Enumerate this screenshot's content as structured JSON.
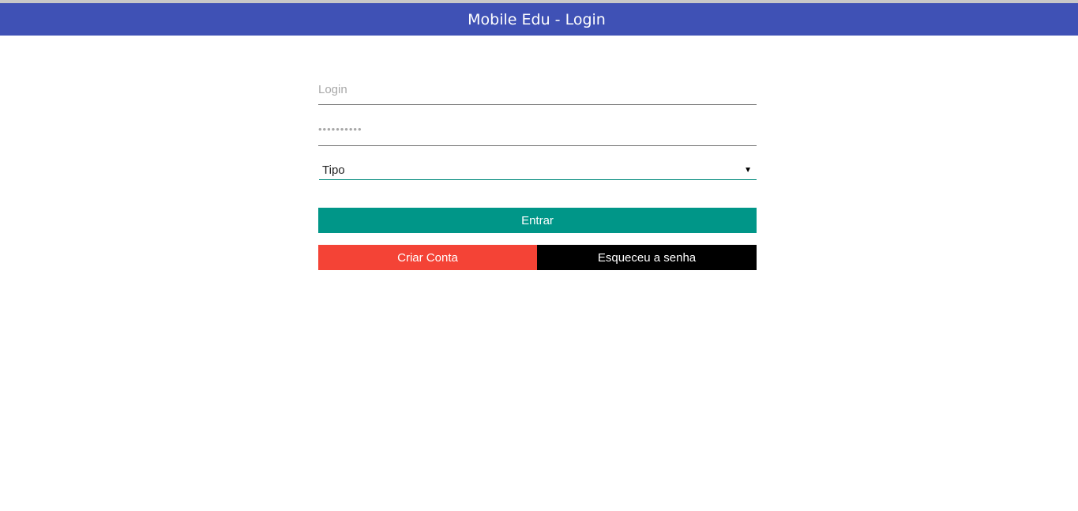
{
  "header": {
    "title": "Mobile Edu - Login"
  },
  "form": {
    "login": {
      "value": "",
      "placeholder": "Login"
    },
    "password": {
      "value": "",
      "placeholder": "••••••••••"
    },
    "tipo": {
      "selected": "Tipo",
      "arrow": "▼"
    }
  },
  "buttons": {
    "enter_label": "Entrar",
    "create_label": "Criar Conta",
    "forgot_label": "Esqueceu a senha"
  },
  "colors": {
    "header": "#3f51b5",
    "enter": "#009688",
    "create": "#f44336",
    "forgot": "#000000"
  }
}
